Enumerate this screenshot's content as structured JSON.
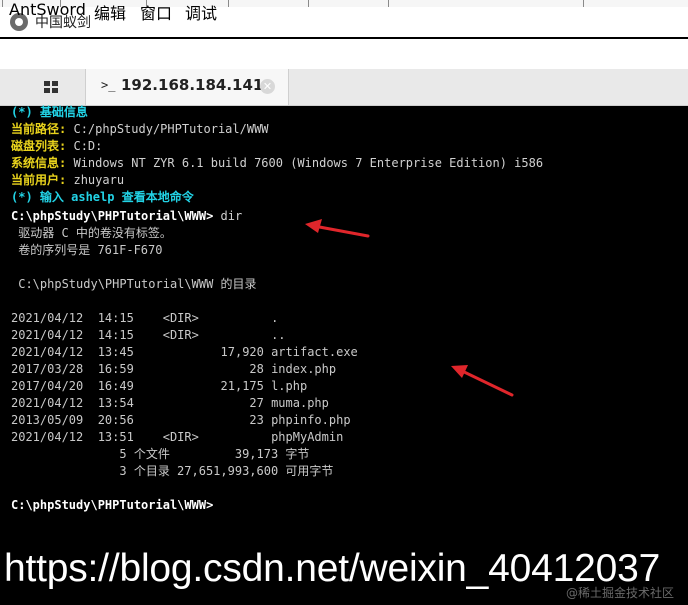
{
  "window": {
    "title": "中国蚁剑",
    "app_icon": "antsword-logo-icon"
  },
  "menu": [
    "AntSword",
    "编辑",
    "窗口",
    "调试"
  ],
  "tabs": {
    "home_icon": "grid-icon",
    "active": {
      "prompt_icon": ">_",
      "label": "192.168.184.141",
      "close_icon": "close-icon"
    }
  },
  "terminal": {
    "header": "(*) 基础信息",
    "info": [
      {
        "label": "当前路径:",
        "value": "C:/phpStudy/PHPTutorial/WWW"
      },
      {
        "label": "磁盘列表:",
        "value": "C:D:"
      },
      {
        "label": "系统信息:",
        "value": "Windows NT ZYR 6.1 build 7600 (Windows 7 Enterprise Edition) i586"
      },
      {
        "label": "当前用户:",
        "value": "zhuyaru"
      }
    ],
    "hint": "(*) 输入 ashelp 查看本地命令",
    "prompt1": "C:\\phpStudy\\PHPTutorial\\WWW>",
    "command": "dir",
    "output": [
      " 驱动器 C 中的卷没有标签。",
      " 卷的序列号是 761F-F670",
      "",
      " C:\\phpStudy\\PHPTutorial\\WWW 的目录",
      "",
      "2021/04/12  14:15    <DIR>          .",
      "2021/04/12  14:15    <DIR>          ..",
      "2021/04/12  13:45            17,920 artifact.exe",
      "2017/03/28  16:59                28 index.php",
      "2017/04/20  16:49            21,175 l.php",
      "2021/04/12  13:54                27 muma.php",
      "2013/05/09  20:56                23 phpinfo.php",
      "2021/04/12  13:51    <DIR>          phpMyAdmin",
      "               5 个文件         39,173 字节",
      "               3 个目录 27,651,993,600 可用字节"
    ],
    "prompt2": "C:\\phpStudy\\PHPTutorial\\WWW>"
  },
  "watermark": "https://blog.csdn.net/weixin_40412037",
  "watermark_small": "@稀土掘金技术社区",
  "colors": {
    "terminal_bg": "#000000",
    "header_cyan": "#22d3e6",
    "label_yellow": "#e8d21c",
    "arrow_red": "#e0262b"
  }
}
